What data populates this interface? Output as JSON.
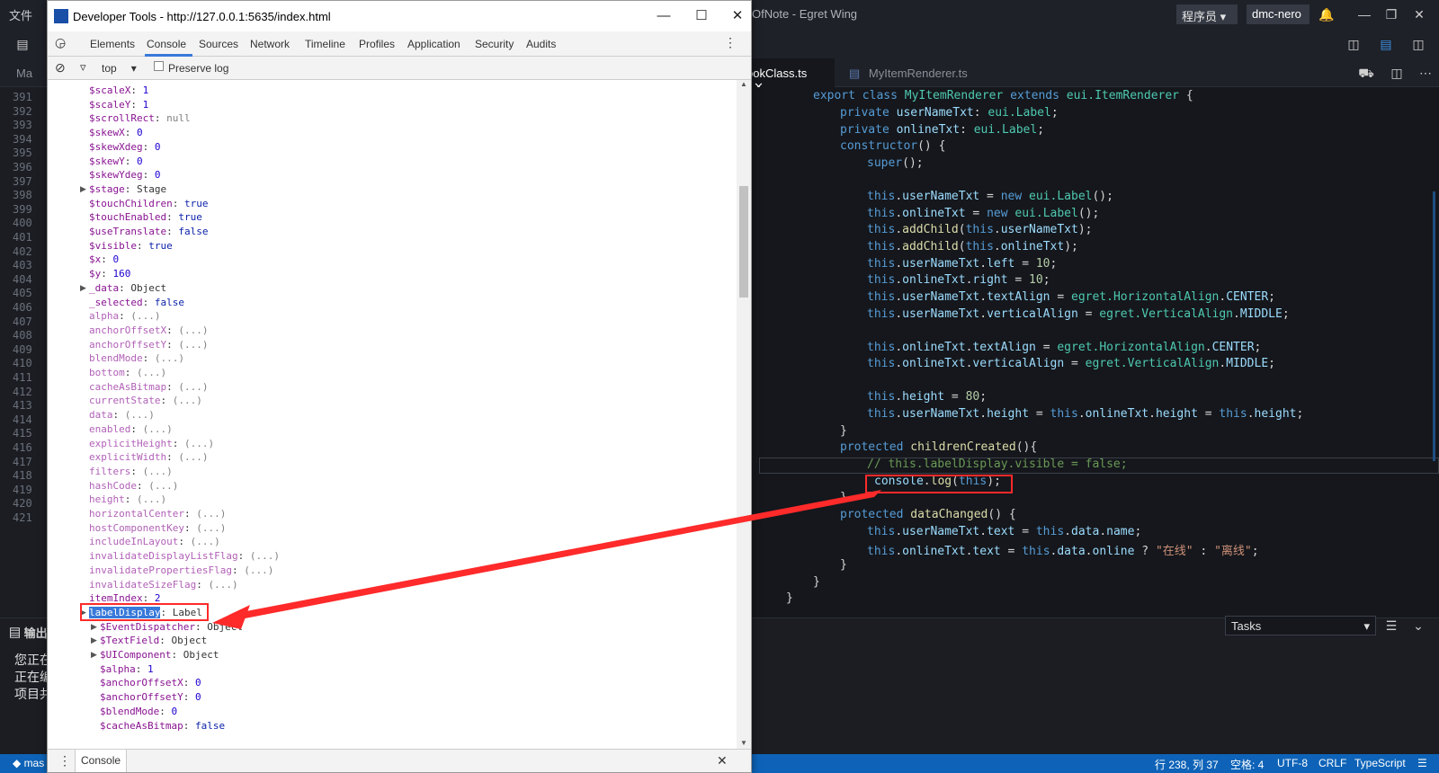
{
  "ide": {
    "menu_file": "文件",
    "title": "OfNote - Egret Wing",
    "user_dropdown": "程序员 ▾",
    "account": "dmc-nero",
    "tabs": [
      "Ma",
      "ookClass.ts",
      "MyItemRenderer.ts"
    ],
    "gutter_lines": [
      "391",
      "392",
      "393",
      "394",
      "395",
      "396",
      "397",
      "398",
      "399",
      "400",
      "401",
      "402",
      "403",
      "404",
      "405",
      "406",
      "407",
      "408",
      "409",
      "410",
      "411",
      "412",
      "413",
      "414",
      "415",
      "416",
      "417",
      "418",
      "419",
      "420",
      "421"
    ],
    "panel": {
      "label": "输出",
      "lines": [
        "您正在",
        "正在编",
        "项目共"
      ],
      "tasks_select": "Tasks"
    },
    "status": {
      "branch": "mas",
      "position": "行 238, 列 37",
      "spaces": "空格: 4",
      "encoding": "UTF-8",
      "eol": "CRLF",
      "language": "TypeScript"
    }
  },
  "code": {
    "l1": "export class MyItemRenderer extends eui.ItemRenderer {",
    "l2": "private userNameTxt: eui.Label;",
    "l3": "private onlineTxt: eui.Label;",
    "l4": "constructor() {",
    "l5": "super();",
    "l6": "this.userNameTxt = new eui.Label();",
    "l7": "this.onlineTxt = new eui.Label();",
    "l8": "this.addChild(this.userNameTxt);",
    "l9": "this.addChild(this.onlineTxt);",
    "l10": "this.userNameTxt.left = 10;",
    "l11": "this.onlineTxt.right = 10;",
    "l12": "this.userNameTxt.textAlign = egret.HorizontalAlign.CENTER;",
    "l13": "this.userNameTxt.verticalAlign = egret.VerticalAlign.MIDDLE;",
    "l14": "this.onlineTxt.textAlign = egret.HorizontalAlign.CENTER;",
    "l15": "this.onlineTxt.verticalAlign = egret.VerticalAlign.MIDDLE;",
    "l16": "this.height = 80;",
    "l17": "this.userNameTxt.height = this.onlineTxt.height = this.height;",
    "l18": "}",
    "l19": "protected childrenCreated(){",
    "l20": "// this.labelDisplay.visible = false;",
    "l21": "console.log(this);",
    "l22": "}",
    "l23": "protected dataChanged() {",
    "l24": "this.userNameTxt.text = this.data.name;",
    "l25": "this.onlineTxt.text = this.data.online ? \"在线\" : \"离线\";",
    "l26": "}",
    "l27": "}",
    "l28": "}"
  },
  "devtools": {
    "title": "Developer Tools - http://127.0.0.1:5635/index.html",
    "tabs": [
      "Elements",
      "Console",
      "Sources",
      "Network",
      "Timeline",
      "Profiles",
      "Application",
      "Security",
      "Audits"
    ],
    "active_tab": "Console",
    "context": "top",
    "preserve_log": "Preserve log",
    "drawer_tab": "Console",
    "props": [
      {
        "k": "$scaleX",
        "v": "1",
        "t": "num"
      },
      {
        "k": "$scaleY",
        "v": "1",
        "t": "num"
      },
      {
        "k": "$scrollRect",
        "v": "null",
        "t": "dim"
      },
      {
        "k": "$skewX",
        "v": "0",
        "t": "num"
      },
      {
        "k": "$skewXdeg",
        "v": "0",
        "t": "num"
      },
      {
        "k": "$skewY",
        "v": "0",
        "t": "num"
      },
      {
        "k": "$skewYdeg",
        "v": "0",
        "t": "num"
      },
      {
        "k": "$stage",
        "v": "Stage",
        "t": "obj",
        "expand": true
      },
      {
        "k": "$touchChildren",
        "v": "true",
        "t": "kw"
      },
      {
        "k": "$touchEnabled",
        "v": "true",
        "t": "kw"
      },
      {
        "k": "$useTranslate",
        "v": "false",
        "t": "kw"
      },
      {
        "k": "$visible",
        "v": "true",
        "t": "kw"
      },
      {
        "k": "$x",
        "v": "0",
        "t": "num"
      },
      {
        "k": "$y",
        "v": "160",
        "t": "num"
      },
      {
        "k": "_data",
        "v": "Object",
        "t": "obj",
        "expand": true
      },
      {
        "k": "_selected",
        "v": "false",
        "t": "kw"
      },
      {
        "k": "alpha",
        "v": "(...)",
        "t": "acc"
      },
      {
        "k": "anchorOffsetX",
        "v": "(...)",
        "t": "acc"
      },
      {
        "k": "anchorOffsetY",
        "v": "(...)",
        "t": "acc"
      },
      {
        "k": "blendMode",
        "v": "(...)",
        "t": "acc"
      },
      {
        "k": "bottom",
        "v": "(...)",
        "t": "acc"
      },
      {
        "k": "cacheAsBitmap",
        "v": "(...)",
        "t": "acc"
      },
      {
        "k": "currentState",
        "v": "(...)",
        "t": "acc"
      },
      {
        "k": "data",
        "v": "(...)",
        "t": "acc"
      },
      {
        "k": "enabled",
        "v": "(...)",
        "t": "acc"
      },
      {
        "k": "explicitHeight",
        "v": "(...)",
        "t": "acc"
      },
      {
        "k": "explicitWidth",
        "v": "(...)",
        "t": "acc"
      },
      {
        "k": "filters",
        "v": "(...)",
        "t": "acc"
      },
      {
        "k": "hashCode",
        "v": "(...)",
        "t": "acc"
      },
      {
        "k": "height",
        "v": "(...)",
        "t": "acc"
      },
      {
        "k": "horizontalCenter",
        "v": "(...)",
        "t": "acc"
      },
      {
        "k": "hostComponentKey",
        "v": "(...)",
        "t": "acc"
      },
      {
        "k": "includeInLayout",
        "v": "(...)",
        "t": "acc"
      },
      {
        "k": "invalidateDisplayListFlag",
        "v": "(...)",
        "t": "acc"
      },
      {
        "k": "invalidatePropertiesFlag",
        "v": "(...)",
        "t": "acc"
      },
      {
        "k": "invalidateSizeFlag",
        "v": "(...)",
        "t": "acc"
      },
      {
        "k": "itemIndex",
        "v": "2",
        "t": "num"
      },
      {
        "k": "labelDisplay",
        "v": "Label",
        "t": "sel",
        "expand": true
      },
      {
        "k": "$EventDispatcher",
        "v": "Object",
        "t": "obj",
        "expand": true,
        "child": true
      },
      {
        "k": "$TextField",
        "v": "Object",
        "t": "obj",
        "expand": true,
        "child": true
      },
      {
        "k": "$UIComponent",
        "v": "Object",
        "t": "obj",
        "expand": true,
        "child": true
      },
      {
        "k": "$alpha",
        "v": "1",
        "t": "num",
        "child": true
      },
      {
        "k": "$anchorOffsetX",
        "v": "0",
        "t": "num",
        "child": true
      },
      {
        "k": "$anchorOffsetY",
        "v": "0",
        "t": "num",
        "child": true
      },
      {
        "k": "$blendMode",
        "v": "0",
        "t": "num",
        "child": true
      },
      {
        "k": "$cacheAsBitmap",
        "v": "false",
        "t": "kw",
        "child": true
      }
    ]
  },
  "colors": {
    "annotation_red": "#ff2a2a",
    "status_blue": "#0e63b8",
    "devtools_accent": "#3879d9"
  }
}
